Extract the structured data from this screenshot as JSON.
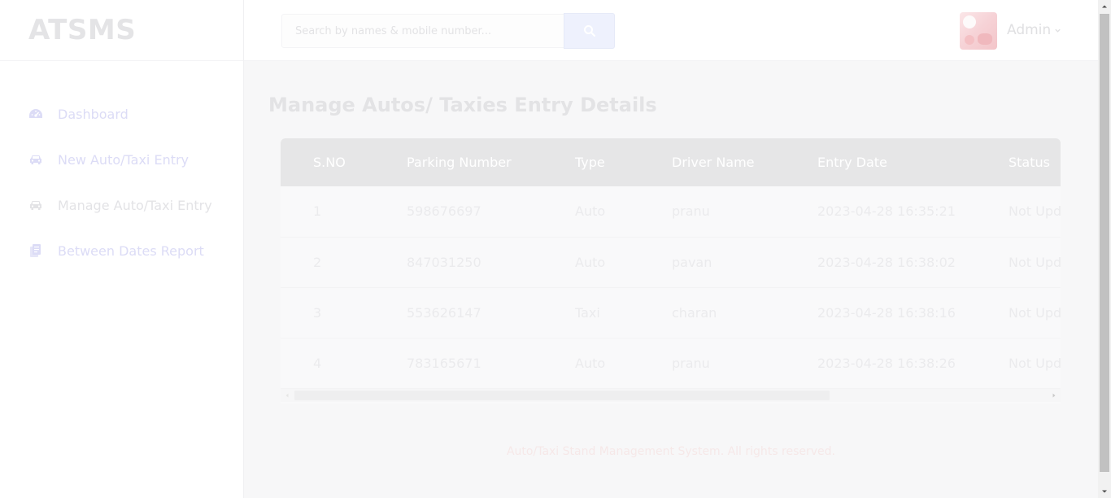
{
  "brand": {
    "name": "ATSMS"
  },
  "sidebar": {
    "items": [
      {
        "label": "Dashboard",
        "icon": "dashboard-gauge-icon",
        "color": "#dcdcf6"
      },
      {
        "label": "New Auto/Taxi Entry",
        "icon": "car-icon",
        "color": "#dcdcf6"
      },
      {
        "label": "Manage Auto/Taxi Entry",
        "icon": "car-icon",
        "color": "#e3e3e6"
      },
      {
        "label": "Between Dates Report",
        "icon": "documents-icon",
        "color": "#dcdcf6"
      }
    ]
  },
  "header": {
    "search_placeholder": "Search by names & mobile number...",
    "search_button_icon": "search-icon",
    "user_name": "Admin"
  },
  "main": {
    "title": "Manage Autos/ Taxies Entry Details",
    "table": {
      "columns": [
        "S.NO",
        "Parking Number",
        "Type",
        "Driver Name",
        "Entry Date",
        "Status"
      ],
      "rows": [
        [
          "1",
          "598676697",
          "Auto",
          "pranu",
          "2023-04-28 16:35:21",
          "Not Upd"
        ],
        [
          "2",
          "847031250",
          "Auto",
          "pavan",
          "2023-04-28 16:38:02",
          "Not Upd"
        ],
        [
          "3",
          "553626147",
          "Taxi",
          "charan",
          "2023-04-28 16:38:16",
          "Not Upd"
        ],
        [
          "4",
          "783165671",
          "Auto",
          "pranu",
          "2023-04-28 16:38:26",
          "Not Upd"
        ]
      ]
    }
  },
  "footer": {
    "text": "Auto/Taxi Stand Management System. All rights reserved."
  },
  "colors": {
    "accent": "#eef1fd",
    "header_row": "#e6e6e7",
    "footer_text": "#f6e8e8"
  }
}
